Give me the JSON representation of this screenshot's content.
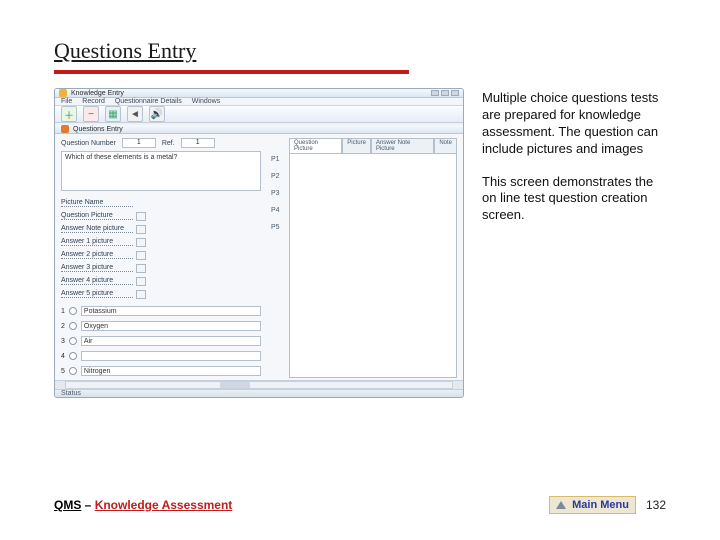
{
  "slide_title": "Questions Entry",
  "side_text": {
    "p1": "Multiple choice questions tests are prepared for knowledge assessment. The question can include pictures and images",
    "p2": "This screen demonstrates the on line test question creation screen."
  },
  "footer": {
    "qms": "QMS",
    "sep": " – ",
    "ka": "Knowledge Assessment",
    "main_menu": "Main Menu",
    "page_num": "132"
  },
  "app": {
    "title": "Knowledge Entry",
    "menus": [
      "File",
      "Record",
      "Questionnaire Details",
      "Windows"
    ],
    "subtitle": "Questions Entry",
    "qnum_label": "Question Number",
    "qnum_value": "1",
    "ref_label": "Ref.",
    "ref_value": "1",
    "question_text": "Which of these elements is a metal?",
    "link_rows": [
      "Picture Name",
      "Question Picture",
      "Answer Note picture",
      "Answer 1 picture",
      "Answer 2 picture",
      "Answer 3 picture",
      "Answer 4 picture",
      "Answer 5 picture"
    ],
    "tabs": [
      "Question Picture",
      "Picture",
      "Answer Note Picture",
      "Note"
    ],
    "answers": [
      "Potassium",
      "Oxygen",
      "Air",
      "",
      "Nitrogen"
    ],
    "p_labels": [
      "P1",
      "P2",
      "P3",
      "P4",
      "P5"
    ],
    "status": "Status"
  }
}
